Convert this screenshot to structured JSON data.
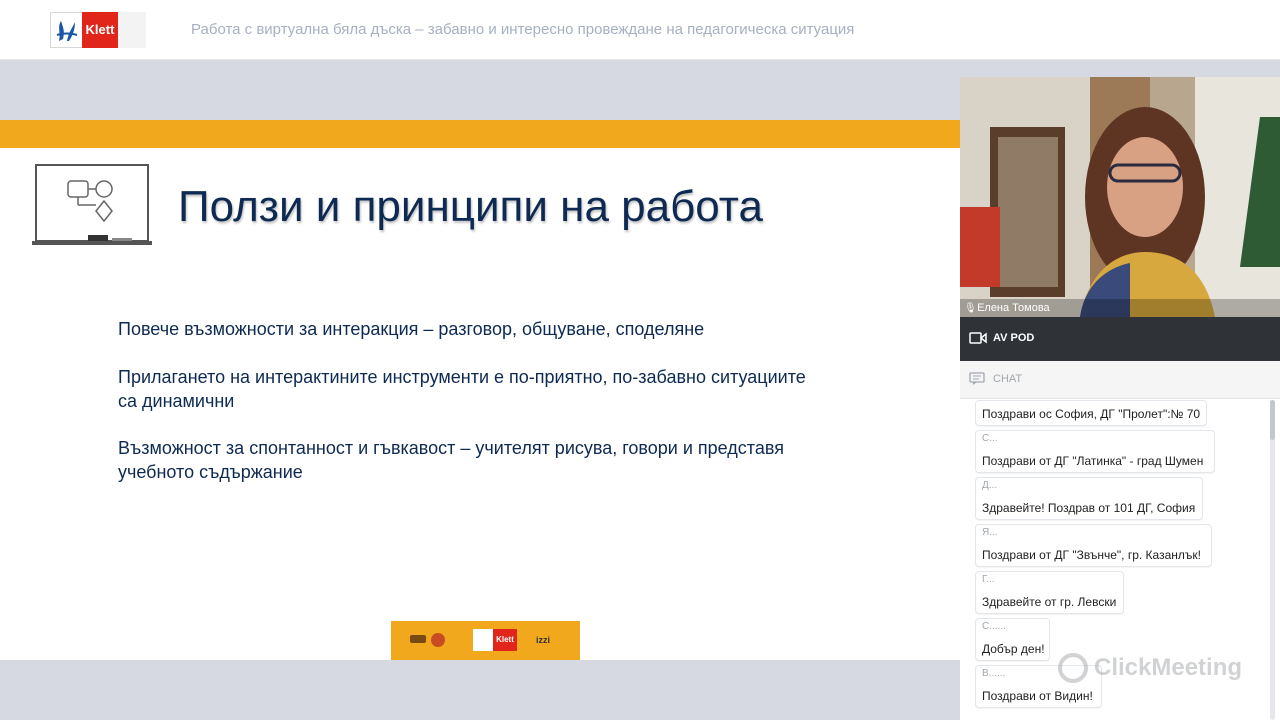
{
  "header": {
    "logo_text": "Klett",
    "title": "Работа с виртуална бяла дъска – забавно и интересно провеждане на педагогическа ситуация"
  },
  "slide": {
    "title": "Ползи и принципи на работа",
    "bullets": [
      "Повече възможности за интеракция – разговор, общуване, споделяне",
      "Прилагането на интерактините инструменти е по-приятно, по-забавно ситуациите са динамични",
      "Възможност за спонтанност и гъвкавост – учителят рисува, говори и представя учебното съдържание"
    ],
    "sponsors": {
      "klett": "Klett",
      "izzi": "izzi"
    },
    "colors": {
      "band": "#f2a81d",
      "title": "#0e2a52"
    }
  },
  "video": {
    "presenter_name": "Елена Томова",
    "mic_icon": "microphone-icon"
  },
  "av_panel": {
    "label": "AV POD",
    "icon": "camera-icon"
  },
  "chat": {
    "label": "CHAT",
    "icon": "chat-icon",
    "messages": [
      {
        "sender": "",
        "text": "Поздрави ос София, ДГ \"Пролет\":№ 70"
      },
      {
        "sender": "С...",
        "text": "Поздрави от ДГ \"Латинка\" - град Шумен"
      },
      {
        "sender": "Д...",
        "text": "Здравейте! Поздрав от 101 ДГ, София"
      },
      {
        "sender": "Я...",
        "text": "Поздрави от ДГ \"Звънче\", гр. Казанлък!"
      },
      {
        "sender": "Г...",
        "text": "Здравейте от гр. Левски"
      },
      {
        "sender": "С......",
        "text": "Добър ден!"
      },
      {
        "sender": "В......",
        "text": "Поздрави от Видин!"
      }
    ]
  },
  "watermark": "ClickMeeting"
}
